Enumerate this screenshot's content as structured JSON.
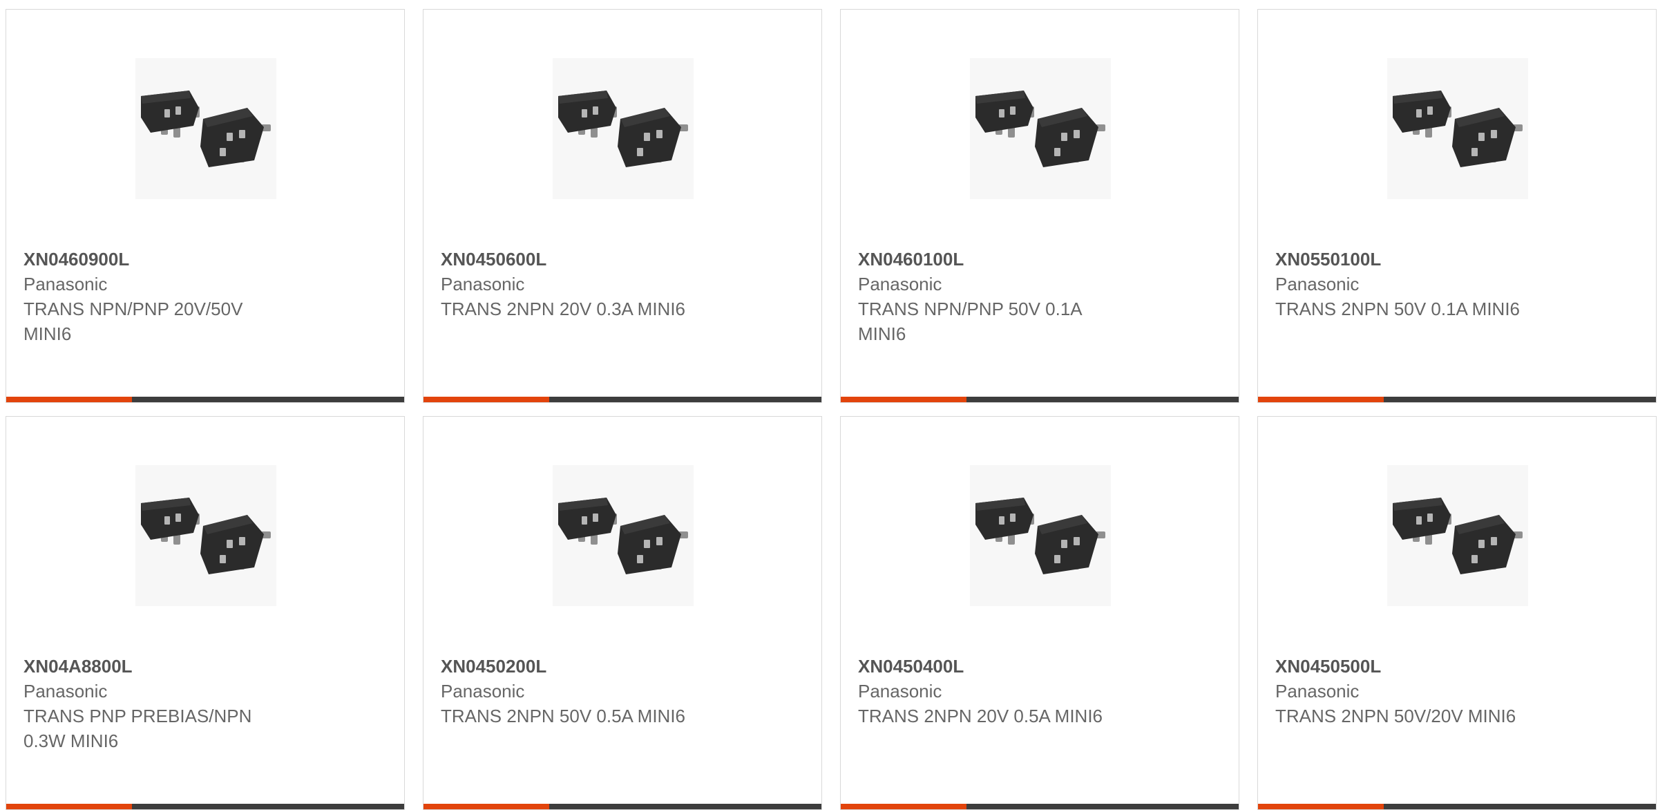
{
  "products": [
    {
      "part_number": "XN0460900L",
      "manufacturer": "Panasonic",
      "description_line1": "TRANS NPN/PNP 20V/50V",
      "description_line2": "MINI6",
      "image_icon": "mini6-transistor-package-icon"
    },
    {
      "part_number": "XN0450600L",
      "manufacturer": "Panasonic",
      "description_line1": "TRANS 2NPN 20V 0.3A MINI6",
      "description_line2": "",
      "image_icon": "mini6-transistor-package-icon"
    },
    {
      "part_number": "XN0460100L",
      "manufacturer": "Panasonic",
      "description_line1": "TRANS NPN/PNP 50V 0.1A",
      "description_line2": "MINI6",
      "image_icon": "mini6-transistor-package-icon"
    },
    {
      "part_number": "XN0550100L",
      "manufacturer": "Panasonic",
      "description_line1": "TRANS 2NPN 50V 0.1A MINI6",
      "description_line2": "",
      "image_icon": "mini6-transistor-package-icon"
    },
    {
      "part_number": "XN04A8800L",
      "manufacturer": "Panasonic",
      "description_line1": "TRANS PNP PREBIAS/NPN",
      "description_line2": "0.3W MINI6",
      "image_icon": "mini6-transistor-package-icon"
    },
    {
      "part_number": "XN0450200L",
      "manufacturer": "Panasonic",
      "description_line1": "TRANS 2NPN 50V 0.5A MINI6",
      "description_line2": "",
      "image_icon": "mini6-transistor-package-icon"
    },
    {
      "part_number": "XN0450400L",
      "manufacturer": "Panasonic",
      "description_line1": "TRANS 2NPN 20V 0.5A MINI6",
      "description_line2": "",
      "image_icon": "mini6-transistor-package-icon"
    },
    {
      "part_number": "XN0450500L",
      "manufacturer": "Panasonic",
      "description_line1": "TRANS 2NPN 50V/20V MINI6",
      "description_line2": "",
      "image_icon": "mini6-transistor-package-icon"
    }
  ],
  "colors": {
    "accent": "#e2440c",
    "bar": "#3d3d3d",
    "border": "#d9d9d9",
    "text": "#666666"
  }
}
